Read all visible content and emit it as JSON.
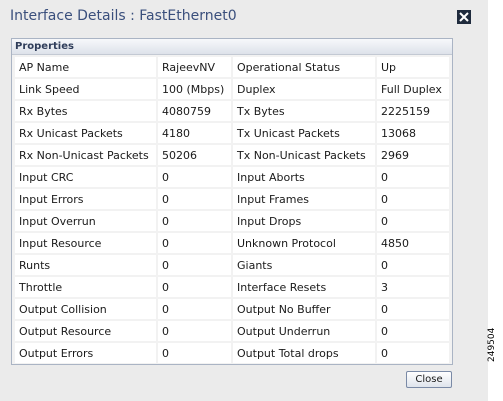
{
  "dialog": {
    "title": "Interface Details : FastEthernet0",
    "close_button_label": "Close",
    "close_icon": "close-x-icon"
  },
  "properties": {
    "header": "Properties",
    "rows": [
      [
        "AP Name",
        "RajeevNV",
        "Operational Status",
        "Up"
      ],
      [
        "Link Speed",
        "100 (Mbps)",
        "Duplex",
        "Full Duplex"
      ],
      [
        "Rx Bytes",
        "4080759",
        "Tx Bytes",
        "2225159"
      ],
      [
        "Rx Unicast Packets",
        "4180",
        "Tx Unicast Packets",
        "13068"
      ],
      [
        "Rx Non-Unicast Packets",
        "50206",
        "Tx Non-Unicast Packets",
        "2969"
      ],
      [
        "Input CRC",
        "0",
        "Input Aborts",
        "0"
      ],
      [
        "Input Errors",
        "0",
        "Input Frames",
        "0"
      ],
      [
        "Input Overrun",
        "0",
        "Input Drops",
        "0"
      ],
      [
        "Input Resource",
        "0",
        "Unknown Protocol",
        "4850"
      ],
      [
        "Runts",
        "0",
        "Giants",
        "0"
      ],
      [
        "Throttle",
        "0",
        "Interface Resets",
        "3"
      ],
      [
        "Output Collision",
        "0",
        "Output No Buffer",
        "0"
      ],
      [
        "Output Resource",
        "0",
        "Output Underrun",
        "0"
      ],
      [
        "Output Errors",
        "0",
        "Output Total drops",
        "0"
      ]
    ]
  },
  "figure_id": "249504"
}
